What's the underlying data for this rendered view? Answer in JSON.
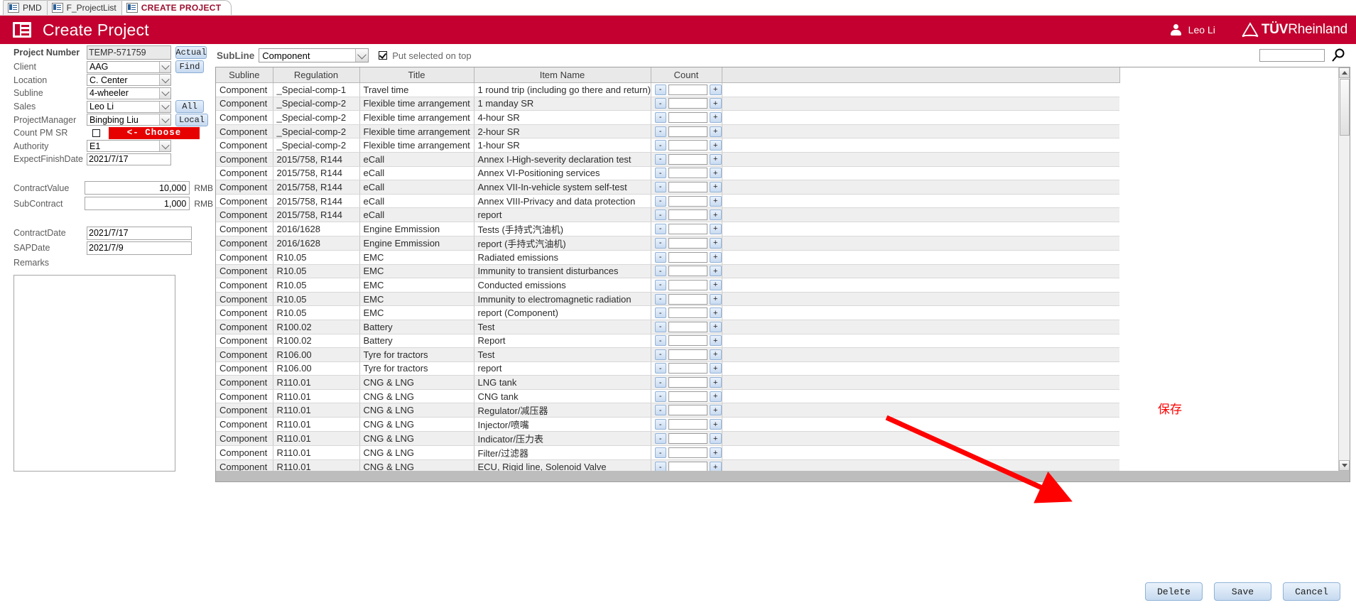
{
  "tabs": [
    {
      "label": "PMD",
      "active": false
    },
    {
      "label": "F_ProjectList",
      "active": false
    },
    {
      "label": "CREATE PROJECT",
      "active": true
    }
  ],
  "header": {
    "title": "Create Project",
    "user": "Leo Li",
    "brand_bold": "TÜV",
    "brand_light": "Rheinland",
    "bg_color": "#c3002f"
  },
  "form": {
    "fields": {
      "project_number": {
        "label": "Project Number",
        "value": "TEMP-571759"
      },
      "client": {
        "label": "Client",
        "value": "AAG"
      },
      "location": {
        "label": "Location",
        "value": "C. Center"
      },
      "subline": {
        "label": "Subline",
        "value": "4-wheeler"
      },
      "sales": {
        "label": "Sales",
        "value": "Leo Li"
      },
      "project_manager": {
        "label": "ProjectManager",
        "value": "Bingbing Liu"
      },
      "count_pm_sr": {
        "label": "Count PM SR",
        "choose_label": "<- Choose"
      },
      "authority": {
        "label": "Authority",
        "value": "E1"
      },
      "expect_finish_date": {
        "label": "ExpectFinishDate",
        "value": "2021/7/17"
      },
      "contract_value": {
        "label": "ContractValue",
        "value": "10,000",
        "unit": "RMB"
      },
      "sub_contract": {
        "label": "SubContract",
        "value": "1,000",
        "unit": "RMB"
      },
      "contract_date": {
        "label": "ContractDate",
        "value": "2021/7/17"
      },
      "sap_date": {
        "label": "SAPDate",
        "value": "2021/7/9"
      },
      "remarks": {
        "label": "Remarks",
        "value": ""
      }
    },
    "side_buttons": {
      "actual": "Actual",
      "find": "Find",
      "all": "All",
      "local": "Local"
    }
  },
  "toolbar": {
    "subline_label": "SubLine",
    "subline_value": "Component",
    "put_selected_label": "Put selected on top",
    "put_selected_checked": true,
    "search_value": "",
    "search_icon": "search-icon"
  },
  "grid": {
    "columns": [
      "Subline",
      "Regulation",
      "Title",
      "Item Name",
      "Count",
      ""
    ],
    "rows": [
      {
        "subline": "Component",
        "regulation": "_Special-comp-1",
        "title": "Travel time",
        "item": "1 round trip (including go there and return)",
        "link": false,
        "count": ""
      },
      {
        "subline": "Component",
        "regulation": "_Special-comp-2",
        "title": "Flexible time arrangement",
        "item": "1 manday SR",
        "link": false,
        "count": ""
      },
      {
        "subline": "Component",
        "regulation": "_Special-comp-2",
        "title": "Flexible time arrangement",
        "item": "4-hour SR",
        "link": false,
        "count": ""
      },
      {
        "subline": "Component",
        "regulation": "_Special-comp-2",
        "title": "Flexible time arrangement",
        "item": "2-hour SR",
        "link": false,
        "count": ""
      },
      {
        "subline": "Component",
        "regulation": "_Special-comp-2",
        "title": "Flexible time arrangement",
        "item": "1-hour SR",
        "link": false,
        "count": ""
      },
      {
        "subline": "Component",
        "regulation": "2015/758, R144",
        "title": "eCall",
        "item": "Annex I-High-severity declaration test",
        "link": false,
        "count": ""
      },
      {
        "subline": "Component",
        "regulation": "2015/758, R144",
        "title": "eCall",
        "item": "Annex VI-Positioning services",
        "link": false,
        "count": ""
      },
      {
        "subline": "Component",
        "regulation": "2015/758, R144",
        "title": "eCall",
        "item": "Annex VII-In-vehicle system self-test",
        "link": false,
        "count": ""
      },
      {
        "subline": "Component",
        "regulation": "2015/758, R144",
        "title": "eCall",
        "item": "Annex VIII-Privacy and data protection",
        "link": false,
        "count": ""
      },
      {
        "subline": "Component",
        "regulation": "2015/758, R144",
        "title": "eCall",
        "item": "report",
        "link": true,
        "count": ""
      },
      {
        "subline": "Component",
        "regulation": "2016/1628",
        "title": "Engine Emmission",
        "item": "Tests (手持式汽油机)",
        "link": false,
        "count": ""
      },
      {
        "subline": "Component",
        "regulation": "2016/1628",
        "title": "Engine Emmission",
        "item": "report (手持式汽油机)",
        "link": true,
        "count": ""
      },
      {
        "subline": "Component",
        "regulation": "R10.05",
        "title": "EMC",
        "item": "Radiated emissions",
        "link": false,
        "count": ""
      },
      {
        "subline": "Component",
        "regulation": "R10.05",
        "title": "EMC",
        "item": "Immunity to transient disturbances",
        "link": false,
        "count": ""
      },
      {
        "subline": "Component",
        "regulation": "R10.05",
        "title": "EMC",
        "item": "Conducted emissions",
        "link": false,
        "count": ""
      },
      {
        "subline": "Component",
        "regulation": "R10.05",
        "title": "EMC",
        "item": "Immunity to electromagnetic radiation",
        "link": false,
        "count": ""
      },
      {
        "subline": "Component",
        "regulation": "R10.05",
        "title": "EMC",
        "item": "report (Component)",
        "link": true,
        "count": ""
      },
      {
        "subline": "Component",
        "regulation": "R100.02",
        "title": "Battery",
        "item": "Test",
        "link": false,
        "count": ""
      },
      {
        "subline": "Component",
        "regulation": "R100.02",
        "title": "Battery",
        "item": "Report",
        "link": true,
        "count": ""
      },
      {
        "subline": "Component",
        "regulation": "R106.00",
        "title": "Tyre for tractors",
        "item": "Test",
        "link": false,
        "count": ""
      },
      {
        "subline": "Component",
        "regulation": "R106.00",
        "title": "Tyre for tractors",
        "item": "report",
        "link": true,
        "count": ""
      },
      {
        "subline": "Component",
        "regulation": "R110.01",
        "title": "CNG & LNG",
        "item": "LNG tank",
        "link": false,
        "count": ""
      },
      {
        "subline": "Component",
        "regulation": "R110.01",
        "title": "CNG & LNG",
        "item": "CNG tank",
        "link": false,
        "count": ""
      },
      {
        "subline": "Component",
        "regulation": "R110.01",
        "title": "CNG & LNG",
        "item": "Regulator/减压器",
        "link": false,
        "count": ""
      },
      {
        "subline": "Component",
        "regulation": "R110.01",
        "title": "CNG & LNG",
        "item": "Injector/喷嘴",
        "link": false,
        "count": ""
      },
      {
        "subline": "Component",
        "regulation": "R110.01",
        "title": "CNG & LNG",
        "item": "Indicator/压力表",
        "link": false,
        "count": ""
      },
      {
        "subline": "Component",
        "regulation": "R110.01",
        "title": "CNG & LNG",
        "item": "Filter/过滤器",
        "link": false,
        "count": ""
      },
      {
        "subline": "Component",
        "regulation": "R110.01",
        "title": "CNG & LNG",
        "item": "ECU, Rigid line, Solenoid Valve",
        "link": false,
        "count": ""
      }
    ],
    "step_minus": "-",
    "step_plus": "+"
  },
  "buttons": {
    "delete": "Delete",
    "save": "Save",
    "cancel": "Cancel"
  },
  "annotation": {
    "text": "保存",
    "color": "#ff0000"
  }
}
